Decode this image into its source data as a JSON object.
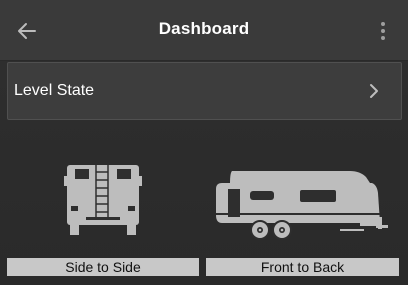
{
  "header": {
    "title": "Dashboard",
    "back_icon": "arrow-left-icon",
    "menu_icon": "overflow-menu-icon"
  },
  "level_state": {
    "label": "Level State",
    "chevron_icon": "chevron-right-icon"
  },
  "options": [
    {
      "label": "Side to Side",
      "image": "camper-rear-view"
    },
    {
      "label": "Front to Back",
      "image": "travel-trailer-side-view"
    }
  ],
  "colors": {
    "background": "#303030",
    "topbar": "#3a3a3a",
    "row_background": "#3d3d3d",
    "icon_gray": "#bdbdbd",
    "button_background": "#c8c8c8",
    "text_white": "#ffffff"
  }
}
